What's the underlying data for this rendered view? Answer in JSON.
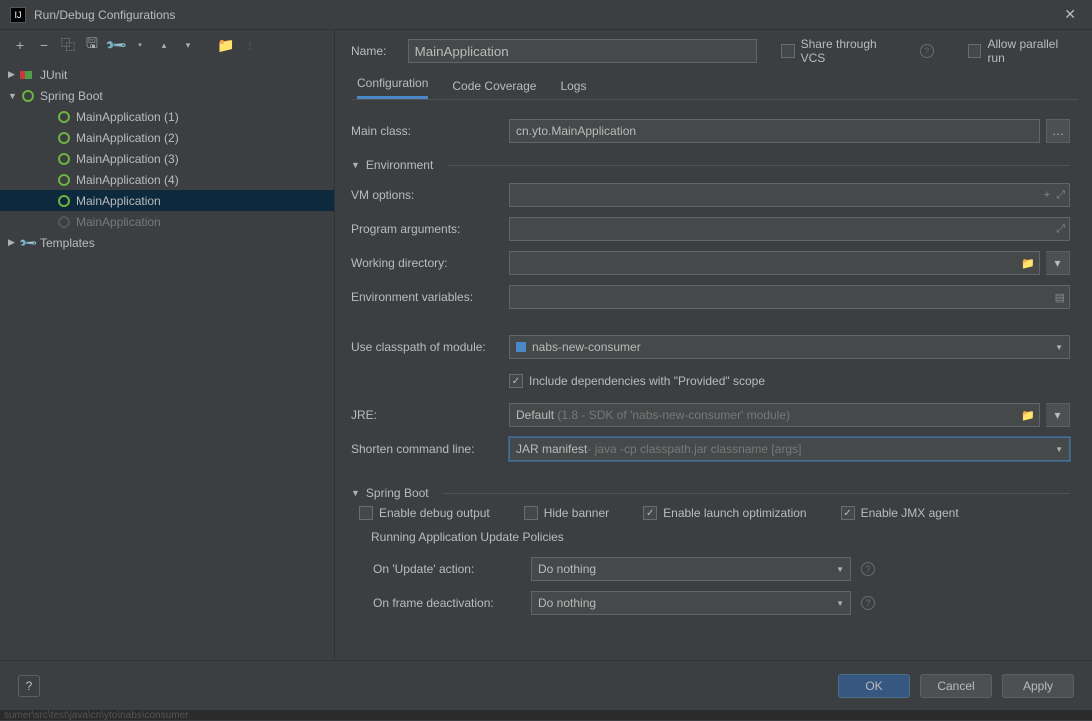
{
  "window": {
    "title": "Run/Debug Configurations"
  },
  "toolbar_icons": [
    "+",
    "−",
    "⿻",
    "🖫",
    "🔧",
    "▴",
    "▾",
    "⇲",
    "↕"
  ],
  "tree": {
    "junit": "JUnit",
    "spring": "Spring Boot",
    "items": [
      "MainApplication (1)",
      "MainApplication (2)",
      "MainApplication (3)",
      "MainApplication (4)",
      "MainApplication",
      "MainApplication"
    ],
    "templates": "Templates"
  },
  "name": {
    "label": "Name:",
    "value": "MainApplication"
  },
  "share_vcs": "Share through VCS",
  "allow_parallel": "Allow parallel run",
  "tabs": [
    "Configuration",
    "Code Coverage",
    "Logs"
  ],
  "form": {
    "main_class_lbl": "Main class:",
    "main_class_val": "cn.yto.MainApplication",
    "env_section": "Environment",
    "vm_options": "VM options:",
    "program_args": "Program arguments:",
    "working_dir": "Working directory:",
    "env_vars": "Environment variables:",
    "classpath_lbl": "Use classpath of module:",
    "classpath_val": "nabs-new-consumer",
    "include_deps": "Include dependencies with \"Provided\" scope",
    "jre_lbl": "JRE:",
    "jre_val": "Default",
    "jre_hint": "(1.8 - SDK of 'nabs-new-consumer' module)",
    "shorten_lbl": "Shorten command line:",
    "shorten_val": "JAR manifest",
    "shorten_hint": " - java -cp classpath.jar classname [args]",
    "spring_section": "Spring Boot",
    "debug_output": "Enable debug output",
    "hide_banner": "Hide banner",
    "launch_opt": "Enable launch optimization",
    "jmx_agent": "Enable JMX agent",
    "policies": "Running Application Update Policies",
    "on_update_lbl": "On 'Update' action:",
    "on_update_val": "Do nothing",
    "on_frame_lbl": "On frame deactivation:",
    "on_frame_val": "Do nothing"
  },
  "buttons": {
    "ok": "OK",
    "cancel": "Cancel",
    "apply": "Apply"
  },
  "statusbar": "sumer\\src\\test\\java\\cn\\yto\\nabs\\consumer"
}
